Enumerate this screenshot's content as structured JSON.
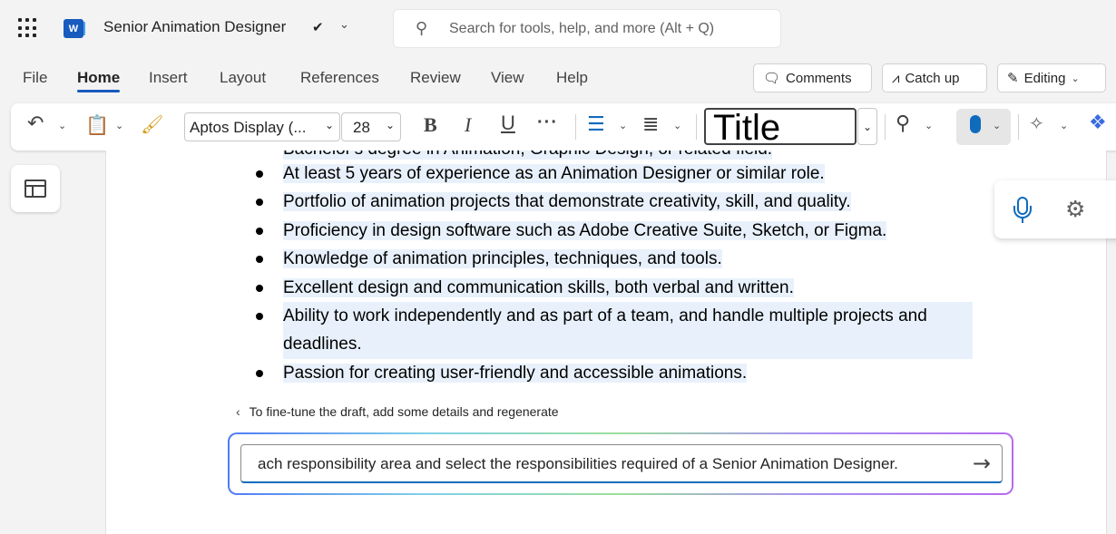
{
  "titlebar": {
    "doc_title": "Senior Animation Designer",
    "search_placeholder": "Search for tools, help, and more (Alt + Q)"
  },
  "menu": {
    "tabs": [
      "File",
      "Home",
      "Insert",
      "Layout",
      "References",
      "Review",
      "View",
      "Help"
    ],
    "active_tab": "Home",
    "comments_label": "Comments",
    "catchup_label": "Catch up",
    "editing_label": "Editing"
  },
  "ribbon": {
    "font_name": "Aptos Display (...",
    "font_size": "28",
    "bold": "B",
    "italic": "I",
    "underline": "U",
    "more": "···",
    "style_name": "Title"
  },
  "document": {
    "partial_line": "Bachelor's degree in Animation, Graphic Design, or related field.",
    "bullets": [
      "At least 5 years of experience as an Animation Designer or similar role.",
      "Portfolio of animation projects that demonstrate creativity, skill, and quality.",
      "Proficiency in design software such as Adobe Creative Suite, Sketch, or Figma.",
      "Knowledge of animation principles, techniques, and tools.",
      "Excellent design and communication skills, both verbal and written.",
      "Ability to work independently and as part of a team, and handle multiple projects and deadlines.",
      "Passion for creating user-friendly and accessible animations."
    ]
  },
  "copilot": {
    "hint": "To fine-tune the draft, add some details and regenerate",
    "prompt_text": "ach responsibility area and select the responsibilities required of a Senior Animation Designer."
  },
  "colors": {
    "accent": "#185abd",
    "highlight": "#e8f1fb",
    "mic": "#0f6cbd"
  }
}
